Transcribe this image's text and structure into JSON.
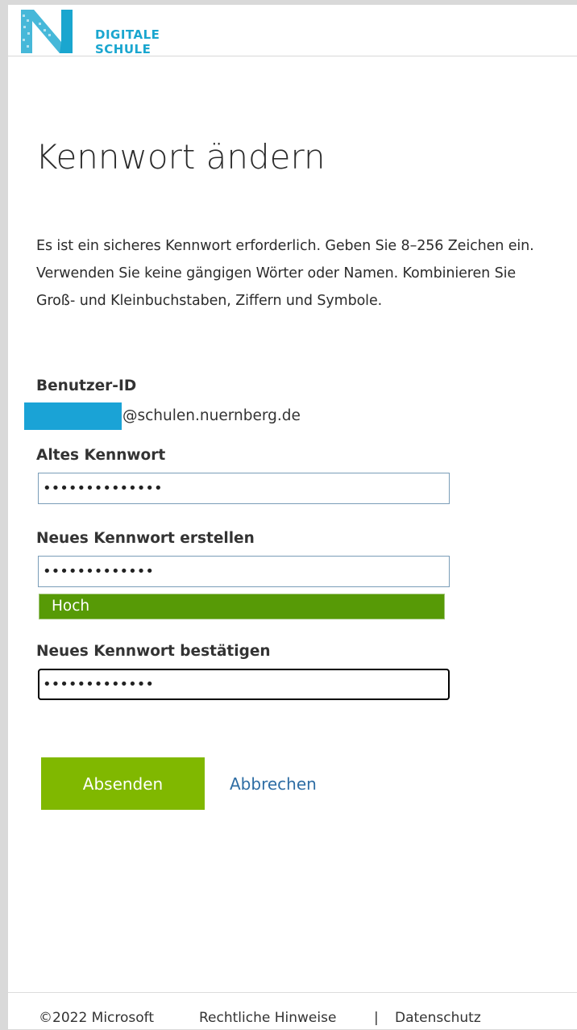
{
  "header": {
    "logo_line1": "DIGITALE",
    "logo_line2": "SCHULE"
  },
  "title": "Kennwort ändern",
  "intro": "Es ist ein sicheres Kennwort erforderlich. Geben Sie 8–256 Zeichen ein. Verwenden Sie keine gängigen Wörter oder Namen. Kombinieren Sie Groß- und Kleinbuchstaben, Ziffern und Symbole.",
  "user": {
    "label": "Benutzer-ID",
    "domain": "@schulen.nuernberg.de"
  },
  "old_password": {
    "label": "Altes Kennwort",
    "value": "••••••••••••••"
  },
  "new_password": {
    "label": "Neues Kennwort erstellen",
    "value": "•••••••••••••",
    "strength": "Hoch"
  },
  "confirm_password": {
    "label": "Neues Kennwort bestätigen",
    "value": "•••••••••••••"
  },
  "actions": {
    "submit": "Absenden",
    "cancel": "Abbrechen"
  },
  "footer": {
    "copyright": "©2022 Microsoft",
    "legal": "Rechtliche Hinweise",
    "separator": "|",
    "privacy": "Datenschutz"
  },
  "colors": {
    "brand_blue": "#1aa6cf",
    "submit_green": "#80b800",
    "strength_green": "#579a06",
    "link_blue": "#2e6da4"
  }
}
